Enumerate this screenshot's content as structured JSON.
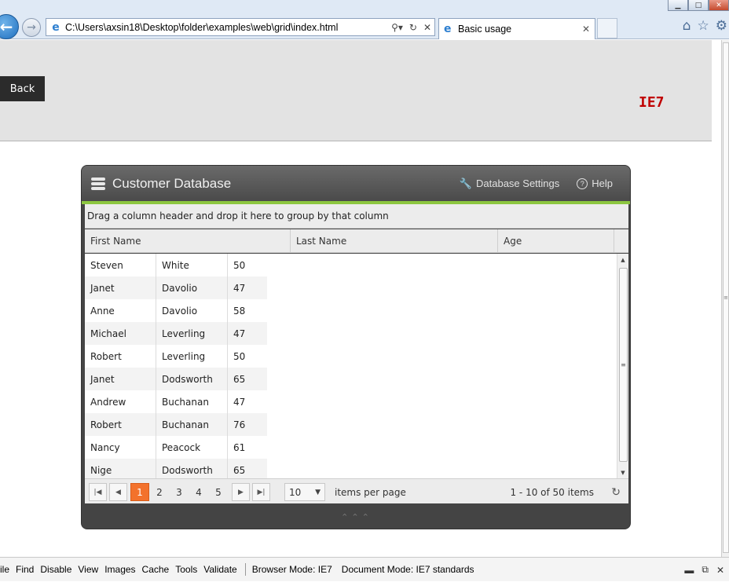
{
  "browser": {
    "address": "C:\\Users\\axsin18\\Desktop\\folder\\examples\\web\\grid\\index.html",
    "tab_title": "Basic usage",
    "back_glyph": "←",
    "forward_glyph": "→"
  },
  "page": {
    "back_label": "Back",
    "browser_badge": "IE7"
  },
  "grid": {
    "title": "Customer Database",
    "settings_label": "Database Settings",
    "help_label": "Help",
    "group_hint": "Drag a column header and drop it here to group by that column",
    "columns": [
      "First Name",
      "Last Name",
      "Age"
    ],
    "rows": [
      {
        "first": "Steven",
        "last": "White",
        "age": "50"
      },
      {
        "first": "Janet",
        "last": "Davolio",
        "age": "47"
      },
      {
        "first": "Anne",
        "last": "Davolio",
        "age": "58"
      },
      {
        "first": "Michael",
        "last": "Leverling",
        "age": "47"
      },
      {
        "first": "Robert",
        "last": "Leverling",
        "age": "50"
      },
      {
        "first": "Janet",
        "last": "Dodsworth",
        "age": "65"
      },
      {
        "first": "Andrew",
        "last": "Buchanan",
        "age": "47"
      },
      {
        "first": "Robert",
        "last": "Buchanan",
        "age": "76"
      },
      {
        "first": "Nancy",
        "last": "Peacock",
        "age": "61"
      },
      {
        "first": "Nige",
        "last": "Dodsworth",
        "age": "65"
      }
    ],
    "pager": {
      "pages": [
        "1",
        "2",
        "3",
        "4",
        "5"
      ],
      "current_page": "1",
      "page_size": "10",
      "items_per_page_label": "items per page",
      "info": "1 - 10 of 50 items"
    }
  },
  "devtools": {
    "menu": [
      "ile",
      "Find",
      "Disable",
      "View",
      "Images",
      "Cache",
      "Tools",
      "Validate"
    ],
    "browser_mode": "Browser Mode: IE7",
    "document_mode": "Document Mode: IE7 standards"
  },
  "colors": {
    "accent_green": "#8cc63f",
    "pager_selected": "#f3722c",
    "badge_red": "#c00000"
  }
}
